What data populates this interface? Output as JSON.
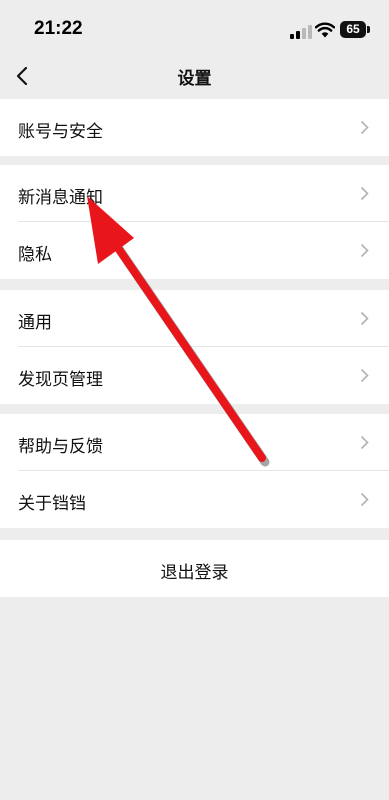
{
  "status_bar": {
    "time": "21:22",
    "battery": "65"
  },
  "nav": {
    "title": "设置"
  },
  "groups": [
    {
      "items": [
        {
          "label": "账号与安全"
        }
      ]
    },
    {
      "items": [
        {
          "label": "新消息通知"
        },
        {
          "label": "隐私"
        }
      ]
    },
    {
      "items": [
        {
          "label": "通用"
        },
        {
          "label": "发现页管理"
        }
      ]
    },
    {
      "items": [
        {
          "label": "帮助与反馈"
        },
        {
          "label": "关于铛铛"
        }
      ]
    }
  ],
  "logout": {
    "label": "退出登录"
  },
  "annotation": {
    "arrow_color": "#e8151b"
  },
  "colors": {
    "background": "#ededed",
    "row_background": "#ffffff"
  }
}
